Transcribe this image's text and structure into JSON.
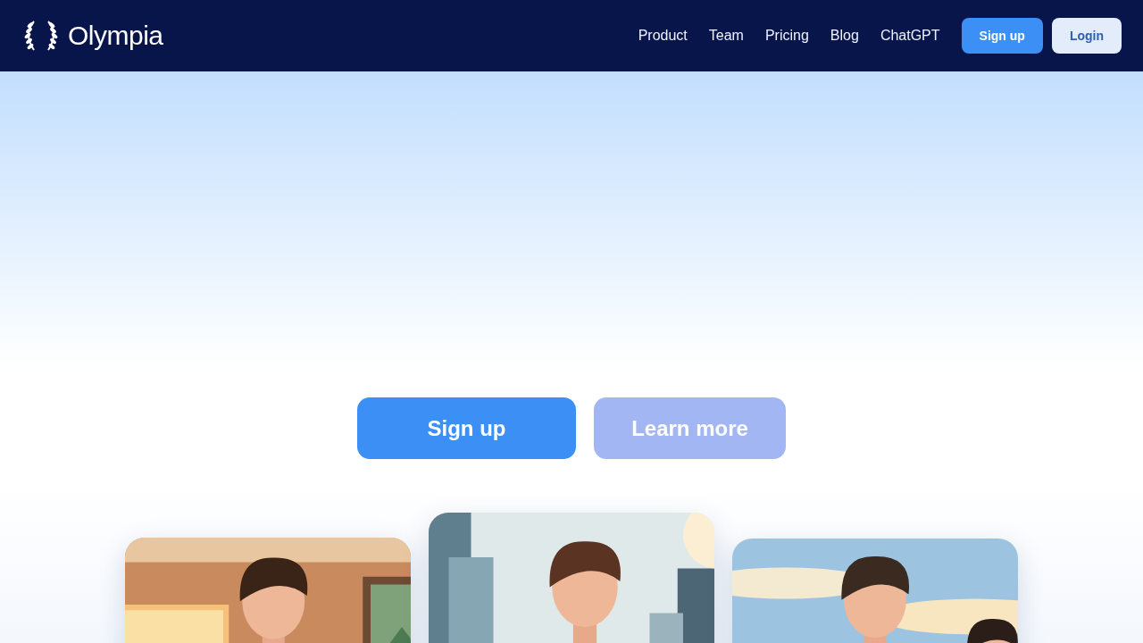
{
  "header": {
    "logo": "Olympia",
    "nav": [
      "Product",
      "Team",
      "Pricing",
      "Blog",
      "ChatGPT"
    ],
    "buttons": [
      {
        "label": "Sign up",
        "kind": "primary"
      },
      {
        "label": "Login",
        "kind": "secondary"
      }
    ]
  },
  "hero": {
    "buttons": [
      {
        "label": "Sign up",
        "kind": "primary"
      },
      {
        "label": "Learn more",
        "kind": "secondary"
      }
    ]
  }
}
